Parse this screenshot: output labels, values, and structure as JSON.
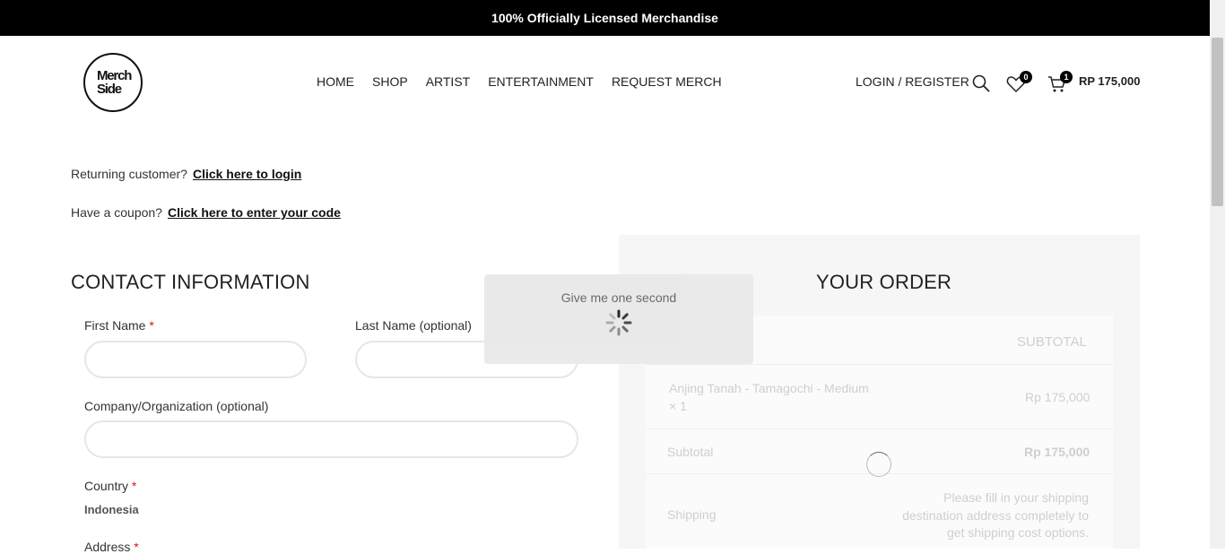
{
  "topbar": {
    "text": "100% Officially Licensed Merchandise"
  },
  "logo": {
    "line1": "Merch",
    "line2": "Side"
  },
  "nav": [
    "HOME",
    "SHOP",
    "ARTIST",
    "ENTERTAINMENT",
    "REQUEST MERCH"
  ],
  "header": {
    "login": "LOGIN / REGISTER",
    "wishlist_count": "0",
    "cart_count": "1",
    "cart_total": "RP 175,000"
  },
  "notices": {
    "returning_label": "Returning customer?",
    "returning_link": "Click here to login",
    "coupon_label": "Have a coupon?",
    "coupon_link": "Click here to enter your code"
  },
  "contact": {
    "title": "CONTACT INFORMATION",
    "first_name": "First Name",
    "last_name": "Last Name (optional)",
    "company": "Company/Organization (optional)",
    "country": "Country",
    "country_value": "Indonesia",
    "address": "Address",
    "required_mark": "*"
  },
  "order": {
    "title": "YOUR ORDER",
    "subtotal_header": "SUBTOTAL",
    "item_name": "Anjing Tanah - Tamagochi - Medium",
    "item_qty": "× 1",
    "item_price": "Rp 175,000",
    "subtotal_label": "Subtotal",
    "subtotal_value": "Rp 175,000",
    "shipping_label": "Shipping",
    "shipping_note_1": "Please fill in your shipping",
    "shipping_note_2": "destination address completely to",
    "shipping_note_3": "get shipping cost options."
  },
  "overlay": {
    "text": "Give me one second"
  },
  "colors": {
    "topbar": "#000000",
    "required": "#e01020",
    "panel": "#f6f6f6"
  }
}
